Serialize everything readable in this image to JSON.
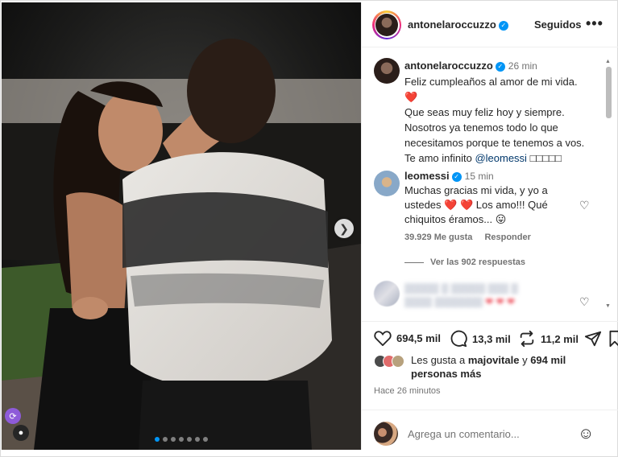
{
  "post": {
    "username": "antonelaroccuzzo",
    "follow_label": "Seguidos",
    "more_label": "•••"
  },
  "caption": {
    "username": "antonelaroccuzzo",
    "time": "26 min",
    "line1": "Feliz cumpleaños al amor de mi vida.",
    "heart": "❤️",
    "line2": "Que seas muy feliz hoy y siempre. Nosotros ya tenemos todo lo que necesitamos porque te tenemos a vos. Te amo infinito",
    "mention": "@leomessi",
    "trailing_emojis": "□□□□□"
  },
  "reply": {
    "username": "leomessi",
    "time": "15 min",
    "text_a": "Muchas gracias mi vida, y yo a ustedes",
    "hearts": "❤️ ❤️",
    "text_b": "Los amo!!! Qué chiquitos éramos...",
    "emoji": "😛",
    "likes": "39.929 Me gusta",
    "reply_label": "Responder",
    "view_replies": "Ver las 902 respuestas"
  },
  "blurred_comment": {
    "line1": "▒▒▒▒▒ ▒ ▒▒▒▒▒ ▒▒▒ ▒",
    "line2": "▒▒▒▒ ▒▒▒▒▒▒▒",
    "hearts": "❤ ❤ ❤"
  },
  "actions": {
    "likes": "694,5 mil",
    "comments": "13,3 mil",
    "shares": "11,2 mil"
  },
  "liked_by": {
    "prefix": "Les gusta a",
    "user": "majovitale",
    "connector": "y",
    "others": "694 mil personas más"
  },
  "timestamp": "Hace 26 minutos",
  "add_comment": {
    "placeholder": "Agrega un comentario..."
  },
  "carousel": {
    "total": 7,
    "active": 0
  },
  "icons": {
    "next": "chevron-right-icon",
    "verified": "verified-badge-icon",
    "like": "heart-icon",
    "comment": "comment-icon",
    "share": "repost-icon",
    "send": "send-icon",
    "save": "bookmark-icon",
    "emoji": "emoji-icon"
  },
  "colors": {
    "accent": "#0095f6",
    "heart": "#ed4956",
    "mention": "#00376b",
    "muted": "#737373"
  }
}
